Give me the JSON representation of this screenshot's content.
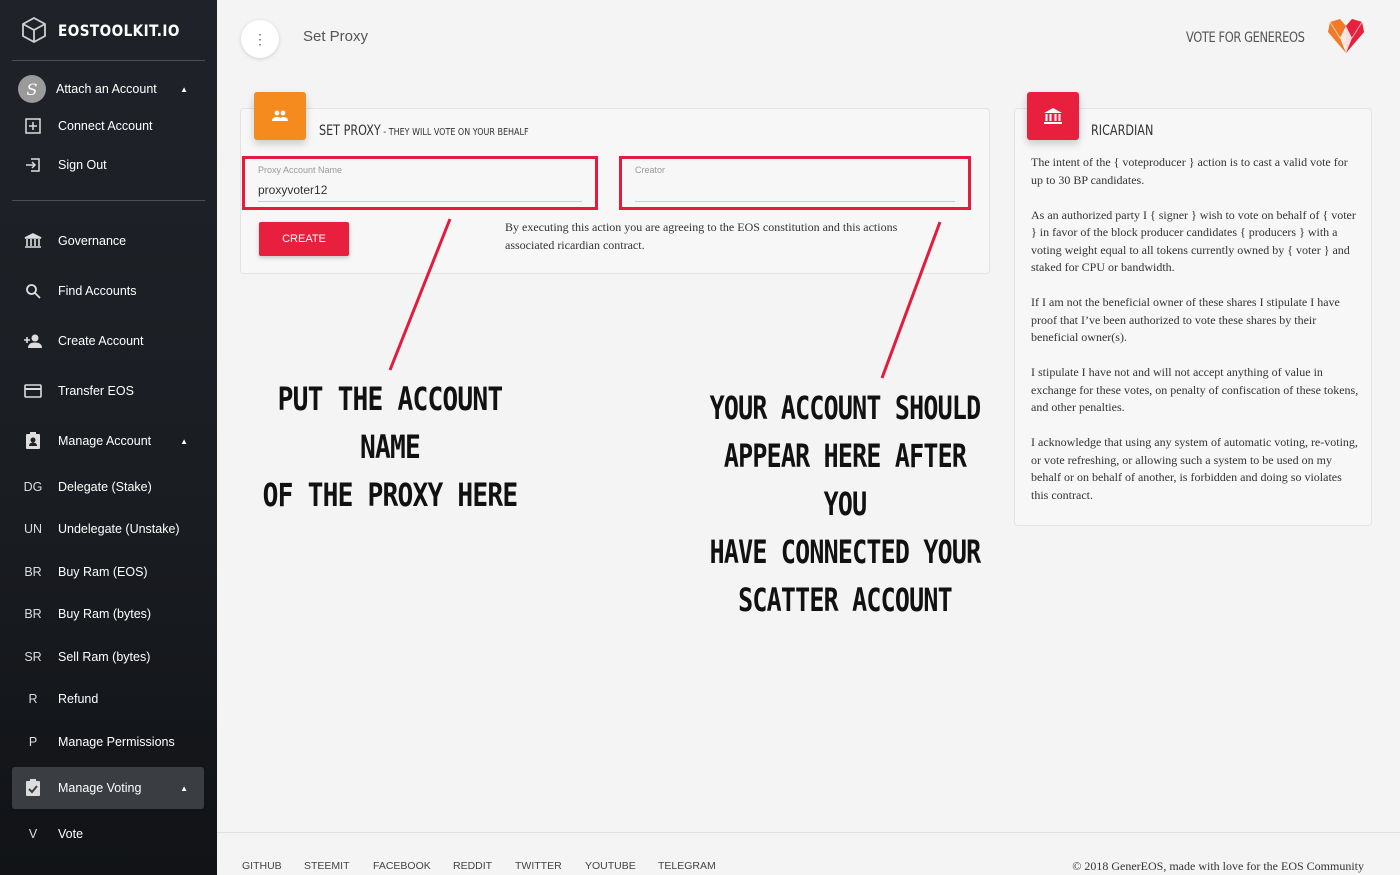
{
  "brand": {
    "name": "EOSTOOLKIT.IO"
  },
  "header": {
    "title": "Set Proxy",
    "vote_link": "VOTE FOR GENEREOS"
  },
  "sidebar": {
    "account": {
      "label": "Attach an Account"
    },
    "items": [
      {
        "label": "Connect Account",
        "icon": "plus-box-icon"
      },
      {
        "label": "Sign Out",
        "icon": "sign-out-icon"
      },
      {
        "label": "Governance",
        "icon": "bank-icon"
      },
      {
        "label": "Find Accounts",
        "icon": "search-icon"
      },
      {
        "label": "Create Account",
        "icon": "person-add-icon"
      },
      {
        "label": "Transfer EOS",
        "icon": "card-icon"
      },
      {
        "label": "Manage Account",
        "icon": "contact-icon"
      },
      {
        "abbr": "DG",
        "label": "Delegate (Stake)"
      },
      {
        "abbr": "UN",
        "label": "Undelegate (Unstake)"
      },
      {
        "abbr": "BR",
        "label": "Buy Ram (EOS)"
      },
      {
        "abbr": "BR",
        "label": "Buy Ram (bytes)"
      },
      {
        "abbr": "SR",
        "label": "Sell Ram (bytes)"
      },
      {
        "abbr": "R",
        "label": "Refund"
      },
      {
        "abbr": "P",
        "label": "Manage Permissions"
      },
      {
        "label": "Manage Voting",
        "icon": "clipboard-check-icon"
      },
      {
        "abbr": "V",
        "label": "Vote"
      }
    ]
  },
  "set_proxy": {
    "heading": "SET PROXY",
    "subheading": " - THEY WILL VOTE ON YOUR BEHALF",
    "proxy_field": {
      "label": "Proxy Account Name",
      "value": "proxyvoter12"
    },
    "creator_field": {
      "label": "Creator",
      "value": ""
    },
    "create_label": "CREATE",
    "agreement": "By executing this action you are agreeing to the EOS constitution and this actions associated ricardian contract."
  },
  "ricardian": {
    "heading": "RICARDIAN",
    "paragraphs": [
      "The intent of the { voteproducer } action is to cast a valid vote for up to 30 BP candidates.",
      "As an authorized party I { signer } wish to vote on behalf of { voter } in favor of the block producer candidates { producers } with a voting weight equal to all tokens currently owned by { voter } and staked for CPU or bandwidth.",
      "If I am not the beneficial owner of these shares I stipulate I have proof that I’ve been authorized to vote these shares by their beneficial owner(s).",
      "I stipulate I have not and will not accept anything of value in exchange for these votes, on penalty of confiscation of these tokens, and other penalties.",
      "I acknowledge that using any system of automatic voting, re-voting, or vote refreshing, or allowing such a system to be used on my behalf or on behalf of another, is forbidden and doing so violates this contract."
    ]
  },
  "annotations": {
    "left": [
      "PUT THE ACCOUNT NAME",
      "OF THE PROXY HERE"
    ],
    "right": [
      "YOUR ACCOUNT SHOULD",
      "APPEAR HERE AFTER YOU",
      "HAVE CONNECTED YOUR",
      "SCATTER ACCOUNT"
    ]
  },
  "footer": {
    "links": [
      "GITHUB",
      "STEEMIT",
      "FACEBOOK",
      "REDDIT",
      "TWITTER",
      "YOUTUBE",
      "TELEGRAM"
    ],
    "copyright": "© 2018 GenerEOS, made with love for the EOS Community"
  },
  "colors": {
    "accent_red": "#e8203d",
    "accent_orange": "#f58a1f",
    "sidebar_bg": "#1f2329"
  }
}
